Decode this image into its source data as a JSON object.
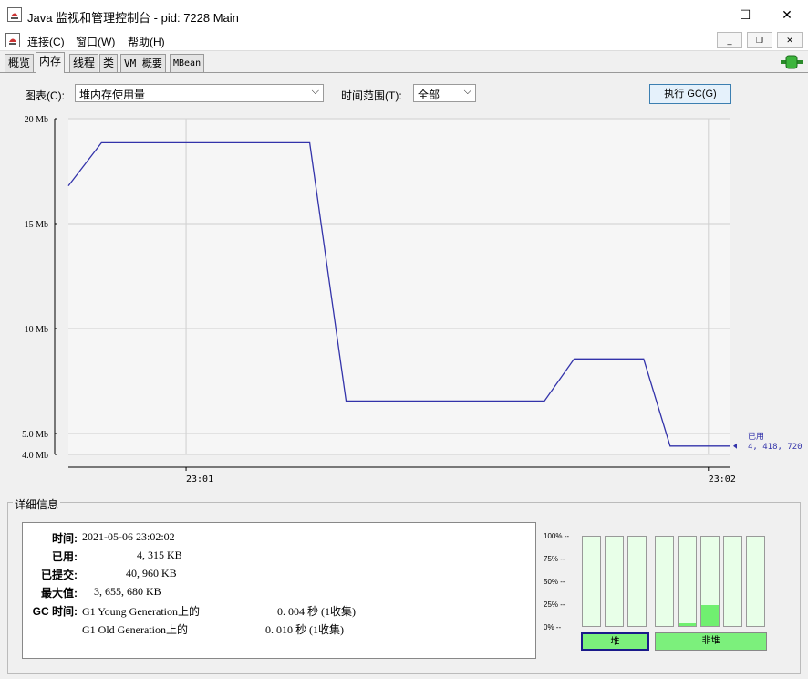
{
  "window": {
    "title": "Java 监视和管理控制台 - pid: 7228 Main",
    "minimize": "—",
    "maximize": "☐",
    "close": "✕"
  },
  "menu": {
    "items": [
      "连接(C)",
      "窗口(W)",
      "帮助(H)"
    ],
    "mdi_min": "_",
    "mdi_restore": "❐",
    "mdi_close": "✕"
  },
  "tabs": [
    "概览",
    "内存",
    "线程",
    "类",
    "VM 概要",
    "MBean"
  ],
  "active_tab": "内存",
  "controls": {
    "chart_label": "图表(C):",
    "chart_value": "堆内存使用量",
    "range_label": "时间范围(T):",
    "range_value": "全部",
    "gc_button": "执行 GC(G)"
  },
  "chart_data": {
    "type": "line",
    "y_tick_labels": [
      "20 Mb",
      "15 Mb",
      "10 Mb",
      "5.0 Mb",
      "4.0 Mb"
    ],
    "y_ticks": [
      20,
      15,
      10,
      5.0,
      4.0
    ],
    "ylim": [
      4.0,
      20.0
    ],
    "x_tick_labels": [
      "23:01",
      "23:02"
    ],
    "series": [
      {
        "x": [
          0,
          0.05,
          0.365,
          0.42,
          0.72,
          0.765,
          0.87,
          0.91,
          1.0
        ],
        "values": [
          16.8,
          18.85,
          18.85,
          6.55,
          6.55,
          8.55,
          8.55,
          4.4,
          4.4
        ],
        "color": "#3333aa"
      }
    ],
    "marker_label": "已用",
    "marker_value": "4, 418, 720",
    "grid": true
  },
  "details": {
    "title": "详细信息",
    "time_label": "时间:",
    "time_value": "2021-05-06 23:02:02",
    "used_label": "已用:",
    "used_value": "4, 315 KB",
    "committed_label": "已提交:",
    "committed_value": "40, 960 KB",
    "max_label": "最大值:",
    "max_value": "3, 655, 680 KB",
    "gc_label": "GC 时间:",
    "gc1_name": "G1 Young Generation上的",
    "gc1_value": "0. 004 秒 (1收集)",
    "gc2_name": "G1 Old Generation上的",
    "gc2_value": "0. 010 秒 (1收集)"
  },
  "pools": {
    "pct_labels": [
      "100% --",
      "75% --",
      "50% --",
      "25% --",
      "0% --"
    ],
    "heap_fill": [
      0.0,
      0.0,
      0.0
    ],
    "nonheap_fill": [
      0.0,
      0.03,
      0.23,
      0.0,
      0.0
    ],
    "heap_label": "堆",
    "nonheap_label": "非堆"
  }
}
